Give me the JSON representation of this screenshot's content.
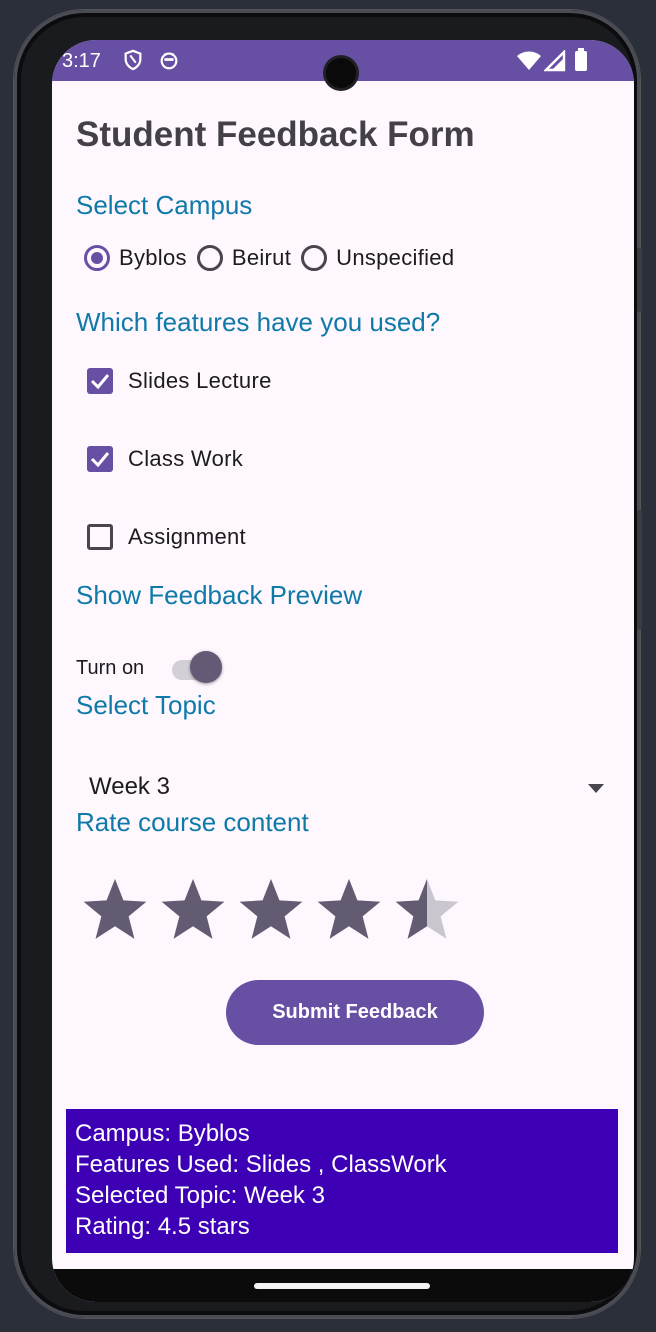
{
  "status_bar": {
    "time": "3:17",
    "left_icons": [
      "shield-icon",
      "android-debug-icon"
    ],
    "right_icons": [
      "wifi-icon",
      "cell-signal-icon",
      "battery-icon"
    ],
    "color": "#674fa3"
  },
  "form": {
    "title": "Student Feedback Form",
    "campus": {
      "heading": "Select Campus",
      "options": [
        {
          "label": "Byblos",
          "selected": true
        },
        {
          "label": "Beirut",
          "selected": false
        },
        {
          "label": "Unspecified",
          "selected": false
        }
      ]
    },
    "features": {
      "heading": "Which features have you used?",
      "items": [
        {
          "label": "Slides Lecture",
          "checked": true
        },
        {
          "label": "Class Work",
          "checked": true
        },
        {
          "label": "Assignment",
          "checked": false
        }
      ]
    },
    "preview_toggle": {
      "heading": "Show Feedback Preview",
      "label": "Turn on",
      "on": true
    },
    "topic": {
      "heading": "Select Topic",
      "selected": "Week 3"
    },
    "rating": {
      "heading": "Rate course content",
      "value": 4.5,
      "max": 5
    },
    "submit_label": "Submit Feedback"
  },
  "preview": {
    "lines": [
      "Campus: Byblos",
      "Features Used: Slides , ClassWork",
      "Selected Topic: Week 3",
      "Rating: 4.5 stars"
    ],
    "background": "#3d00b4"
  },
  "colors": {
    "accent": "#6750a4",
    "section_heading": "#0f7aa8",
    "star_filled": "#625b71",
    "star_empty": "#cac6cf"
  }
}
